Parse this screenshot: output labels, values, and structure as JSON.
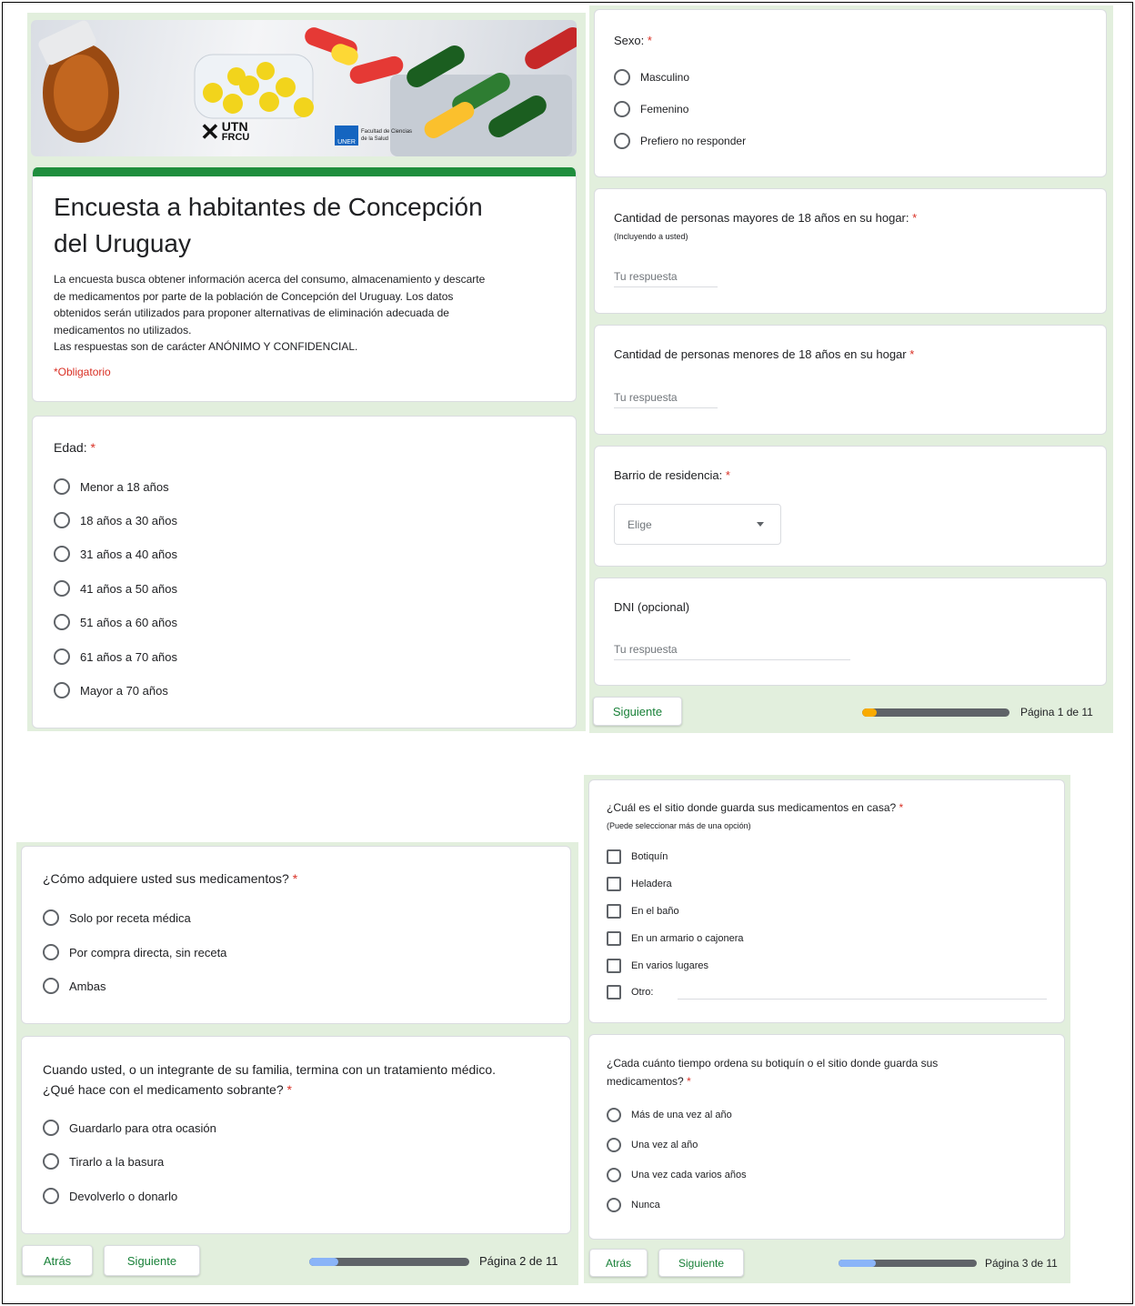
{
  "colors": {
    "panel_bg": "#e2efdd",
    "accent_green": "#188038",
    "header_bar": "#1f8e3d",
    "required": "#d93025",
    "progress_fill_p1": "#f9ab00",
    "progress_fill_p23": "#8ab4f8"
  },
  "page1": {
    "banner": {
      "logo_utn": "UTN",
      "logo_frcu": "FRCU",
      "logo_uner": "UNER",
      "logo_fac_line1": "Facultad de Ciencias",
      "logo_fac_line2": "de la Salud"
    },
    "header": {
      "title_line1": "Encuesta a habitantes de Concepción",
      "title_line2": "del Uruguay",
      "desc_lines": [
        "La encuesta busca obtener información acerca del consumo, almacenamiento y descarte",
        "de medicamentos por parte de la población de Concepción del Uruguay. Los datos",
        "obtenidos serán utilizados para proponer alternativas de eliminación adecuada de",
        "medicamentos no utilizados.",
        "Las respuestas son de carácter ANÓNIMO Y CONFIDENCIAL."
      ],
      "required_note": "*Obligatorio"
    },
    "edad": {
      "title": "Edad:",
      "req": "*",
      "options": [
        "Menor a 18 años",
        "18 años a 30 años",
        "31 años a 40 años",
        "41 años a 50 años",
        "51 años a 60 años",
        "61 años a 70 años",
        "Mayor a 70 años"
      ]
    },
    "sexo": {
      "title": "Sexo:",
      "req": "*",
      "options": [
        "Masculino",
        "Femenino",
        "Prefiero no responder"
      ]
    },
    "mayores": {
      "title": "Cantidad de personas mayores de 18 años en su hogar:",
      "req": "*",
      "subtitle": "(Incluyendo a usted)",
      "placeholder": "Tu respuesta"
    },
    "menores": {
      "title": "Cantidad de personas menores de 18 años en su hogar",
      "req": "*",
      "placeholder": "Tu respuesta"
    },
    "barrio": {
      "title": "Barrio de residencia:",
      "req": "*",
      "select_value": "Elige"
    },
    "dni": {
      "title": "DNI (opcional)",
      "placeholder": "Tu respuesta"
    },
    "footer": {
      "next": "Siguiente",
      "page": "Página 1 de 11",
      "progress": 0.1
    }
  },
  "page2": {
    "adquiere": {
      "title": "¿Cómo adquiere usted sus medicamentos?",
      "req": "*",
      "options": [
        "Solo por receta médica",
        "Por compra directa, sin receta",
        "Ambas"
      ]
    },
    "sobrante": {
      "title_line1": "Cuando usted, o un integrante de su familia, termina con un tratamiento médico.",
      "title_line2": "¿Qué hace con el medicamento sobrante?",
      "req": "*",
      "options": [
        "Guardarlo para otra ocasión",
        "Tirarlo a la basura",
        "Devolverlo o donarlo"
      ]
    },
    "footer": {
      "back": "Atrás",
      "next": "Siguiente",
      "page": "Página 2 de 11",
      "progress": 0.18
    }
  },
  "page3": {
    "sitio": {
      "title": "¿Cuál es el sitio donde guarda sus medicamentos en casa?",
      "req": "*",
      "subtitle": "(Puede seleccionar más de una opción)",
      "options": [
        "Botiquín",
        "Heladera",
        "En el baño",
        "En un armario o cajonera",
        "En varios lugares",
        "Otro:"
      ]
    },
    "ordena": {
      "title_line1": "¿Cada cuánto tiempo ordena su botiquín o el sitio donde guarda sus",
      "title_line2": "medicamentos?",
      "req": "*",
      "options": [
        "Más de una vez al año",
        "Una vez al año",
        "Una vez cada varios años",
        "Nunca"
      ]
    },
    "footer": {
      "back": "Atrás",
      "next": "Siguiente",
      "page": "Página 3 de 11",
      "progress": 0.27
    }
  }
}
